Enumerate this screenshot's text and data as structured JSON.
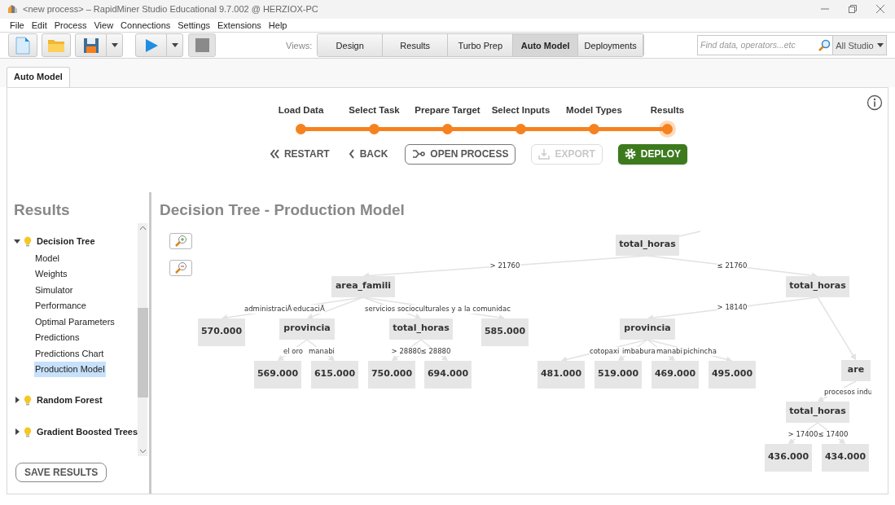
{
  "window": {
    "title": "<new process> – RapidMiner Studio Educational 9.7.002 @ HERZIOX-PC"
  },
  "menu": [
    "File",
    "Edit",
    "Process",
    "View",
    "Connections",
    "Settings",
    "Extensions",
    "Help"
  ],
  "toolbar": {
    "views_label": "Views:",
    "views": [
      {
        "label": "Design",
        "selected": false
      },
      {
        "label": "Results",
        "selected": false
      },
      {
        "label": "Turbo Prep",
        "selected": false
      },
      {
        "label": "Auto Model",
        "selected": true
      },
      {
        "label": "Deployments",
        "selected": false
      }
    ],
    "search": {
      "placeholder": "Find data, operators...etc"
    },
    "scope": "All Studio"
  },
  "tabs": [
    {
      "label": "Auto Model",
      "selected": true
    }
  ],
  "steps": [
    {
      "label": "Load Data",
      "selected": false
    },
    {
      "label": "Select Task",
      "selected": false
    },
    {
      "label": "Prepare Target",
      "selected": false
    },
    {
      "label": "Select Inputs",
      "selected": false
    },
    {
      "label": "Model Types",
      "selected": false
    },
    {
      "label": "Results",
      "selected": true
    }
  ],
  "actions": [
    {
      "kind": "restart",
      "label": "RESTART",
      "disabled": false
    },
    {
      "kind": "back",
      "label": "BACK",
      "disabled": false
    },
    {
      "kind": "open",
      "label": "OPEN PROCESS",
      "disabled": false
    },
    {
      "kind": "export",
      "label": "EXPORT",
      "disabled": true
    },
    {
      "kind": "deploy",
      "label": "DEPLOY",
      "disabled": false
    }
  ],
  "results": {
    "title": "Results",
    "groups": [
      {
        "label": "Decision Tree",
        "expanded": true,
        "children": [
          {
            "label": "Model",
            "selected": false
          },
          {
            "label": "Weights",
            "selected": false
          },
          {
            "label": "Simulator",
            "selected": false
          },
          {
            "label": "Performance",
            "selected": false
          },
          {
            "label": "Optimal Parameters",
            "selected": false
          },
          {
            "label": "Predictions",
            "selected": false
          },
          {
            "label": "Predictions Chart",
            "selected": false
          },
          {
            "label": "Production Model",
            "selected": true
          }
        ]
      },
      {
        "label": "Random Forest",
        "expanded": false
      },
      {
        "label": "Gradient Boosted Trees",
        "expanded": false
      }
    ],
    "save_button": "SAVE RESULTS"
  },
  "model": {
    "title": "Decision Tree - Production Model",
    "tree": {
      "label": "total_horas",
      "kind": "split",
      "children": [
        {
          "edge_label": "> 21760",
          "label": "area_famili",
          "kind": "split",
          "children": [
            {
              "edge_label": "administraciÃ",
              "label": "570.000",
              "kind": "leaf"
            },
            {
              "edge_label": "educaciÃ",
              "label": "provincia",
              "kind": "split",
              "children": [
                {
                  "edge_label": "el oro",
                  "label": "569.000",
                  "kind": "leaf"
                },
                {
                  "edge_label": "manabi",
                  "label": "615.000",
                  "kind": "leaf"
                }
              ]
            },
            {
              "label": "total_horas",
              "kind": "split",
              "children": [
                {
                  "edge_label": "> 28880",
                  "label": "750.000",
                  "kind": "leaf"
                },
                {
                  "edge_label": "≤ 28880",
                  "label": "694.000",
                  "kind": "leaf"
                }
              ]
            },
            {
              "edge_label": "servicios socioculturales y a la comunidac",
              "label": "585.000",
              "kind": "leaf"
            }
          ]
        },
        {
          "edge_label": "≤ 21760",
          "label": "total_horas",
          "kind": "split",
          "children": [
            {
              "edge_label": "> 18140",
              "label": "provincia",
              "kind": "split",
              "children": [
                {
                  "edge_label": "cotopaxi",
                  "label": "481.000",
                  "kind": "leaf"
                },
                {
                  "edge_label": "imbabura",
                  "label": "519.000",
                  "kind": "leaf"
                },
                {
                  "edge_label": "manabi",
                  "label": "469.000",
                  "kind": "leaf"
                },
                {
                  "edge_label": "pichincha",
                  "label": "495.000",
                  "kind": "leaf"
                }
              ]
            },
            {
              "label": "are",
              "kind": "split",
              "children": [
                {
                  "edge_label": "procesos indu",
                  "label": "total_horas",
                  "kind": "split",
                  "children": [
                    {
                      "edge_label": "> 17400",
                      "label": "436.000",
                      "kind": "leaf"
                    },
                    {
                      "edge_label": "≤ 17400",
                      "label": "434.000",
                      "kind": "leaf"
                    }
                  ]
                }
              ]
            }
          ]
        }
      ]
    }
  }
}
